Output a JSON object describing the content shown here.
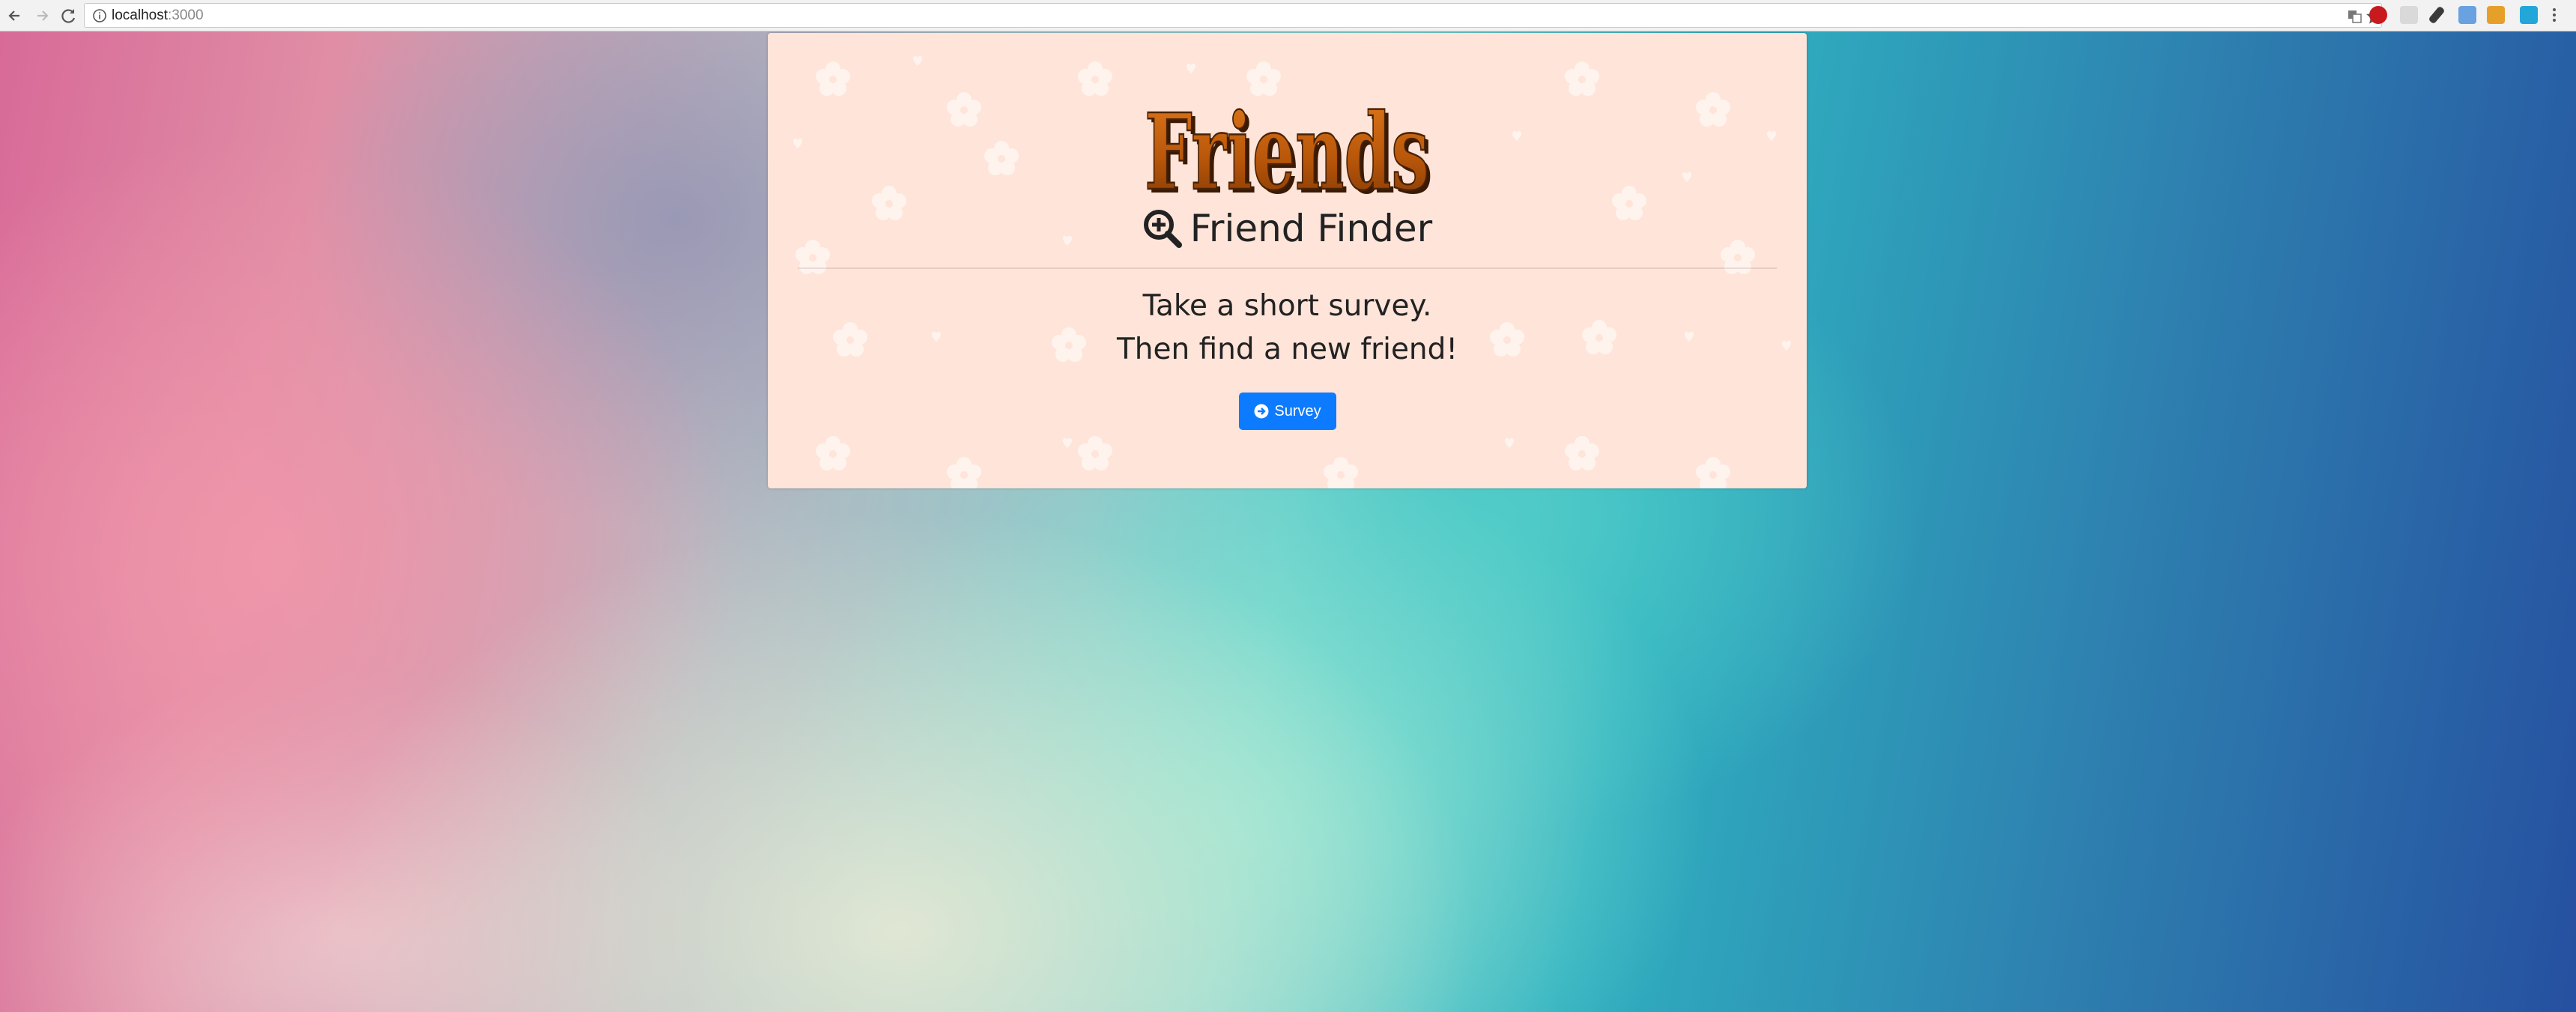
{
  "browser": {
    "url_host": "localhost",
    "url_port": ":3000",
    "icons": {
      "back": "arrow-left-icon",
      "forward": "arrow-right-icon",
      "reload": "reload-icon",
      "info": "info-icon",
      "translate": "translate-icon",
      "bookmark": "star-icon",
      "menu": "kebab-menu-icon"
    }
  },
  "card": {
    "logo_text": "Friends",
    "title": "Friend Finder",
    "lead_line_1": "Take a short survey.",
    "lead_line_2": "Then find a new friend!",
    "survey_button_label": "Survey",
    "background_color": "#ffe4d9",
    "button_color": "#0d7bff"
  }
}
